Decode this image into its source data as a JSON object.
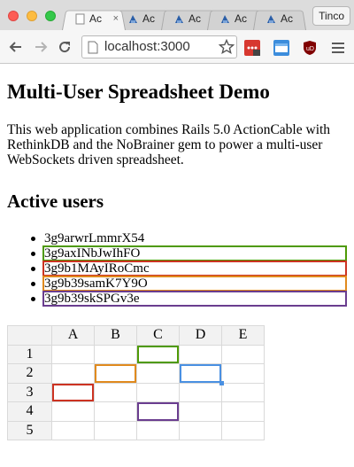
{
  "browser": {
    "tabs": [
      {
        "title": "Ac",
        "active": true,
        "icon": "page-icon"
      },
      {
        "title": "Ac",
        "active": false,
        "icon": "rails-icon"
      },
      {
        "title": "Ac",
        "active": false,
        "icon": "rails-icon"
      },
      {
        "title": "Ac",
        "active": false,
        "icon": "rails-icon"
      },
      {
        "title": "Ac",
        "active": false,
        "icon": "rails-icon"
      }
    ],
    "profile_label": "Tinco",
    "url": "localhost:3000",
    "tab_close_glyph": "×"
  },
  "page": {
    "heading": "Multi-User Spreadsheet Demo",
    "intro": "This web application combines Rails 5.0 ActionCable with RethinkDB and the NoBrainer gem to power a multi-user WebSockets driven spreadsheet.",
    "users_heading": "Active users",
    "users": [
      {
        "name": "3g9arwrLmmrX54",
        "color": ""
      },
      {
        "name": "3g9axINbJwIhFO",
        "color": "#4e9a06"
      },
      {
        "name": "3g9b1MAyIRoCmc",
        "color": "#cc3322"
      },
      {
        "name": "3g9b39samK7Y9O",
        "color": "#e08a1e"
      },
      {
        "name": "3g9b39skSPGv3e",
        "color": "#6a3d8f"
      }
    ]
  },
  "sheet": {
    "columns": [
      "A",
      "B",
      "C",
      "D",
      "E"
    ],
    "rows": [
      "1",
      "2",
      "3",
      "4",
      "5"
    ],
    "selections": [
      {
        "row": 1,
        "col": "C",
        "color": "#4e9a06"
      },
      {
        "row": 2,
        "col": "B",
        "color": "#e08a1e"
      },
      {
        "row": 2,
        "col": "D",
        "color": "#4a90e2"
      },
      {
        "row": 3,
        "col": "A",
        "color": "#cc3322"
      },
      {
        "row": 4,
        "col": "C",
        "color": "#6a3d8f"
      }
    ]
  }
}
